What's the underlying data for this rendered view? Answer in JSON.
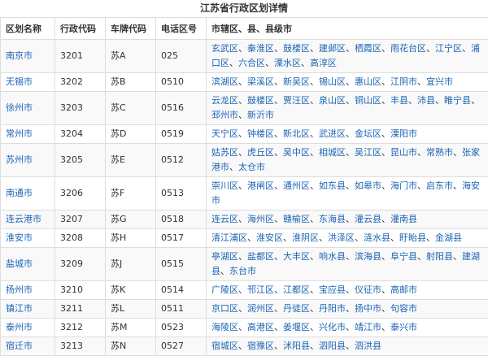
{
  "title": "江苏省行政区划详情",
  "headers": [
    "区划名称",
    "行政代码",
    "车牌代码",
    "电话区号",
    "市辖区、县、县级市"
  ],
  "rows": [
    {
      "name": "南京市",
      "code": "3201",
      "plate": "苏A",
      "area": "025",
      "subs": [
        "玄武区",
        "秦淮区",
        "鼓楼区",
        "建邺区",
        "栖霞区",
        "雨花台区",
        "江宁区",
        "浦口区",
        "六合区",
        "溧水区",
        "高淳区"
      ]
    },
    {
      "name": "无锡市",
      "code": "3202",
      "plate": "苏B",
      "area": "0510",
      "subs": [
        "滨湖区",
        "梁溪区",
        "新吴区",
        "锡山区",
        "惠山区",
        "江阴市",
        "宜兴市"
      ]
    },
    {
      "name": "徐州市",
      "code": "3203",
      "plate": "苏C",
      "area": "0516",
      "subs": [
        "云龙区",
        "鼓楼区",
        "贾汪区",
        "泉山区",
        "铜山区",
        "丰县",
        "沛县",
        "睢宁县",
        "邳州市",
        "新沂市"
      ]
    },
    {
      "name": "常州市",
      "code": "3204",
      "plate": "苏D",
      "area": "0519",
      "subs": [
        "天宁区",
        "钟楼区",
        "新北区",
        "武进区",
        "金坛区",
        "溧阳市"
      ]
    },
    {
      "name": "苏州市",
      "code": "3205",
      "plate": "苏E",
      "area": "0512",
      "subs": [
        "姑苏区",
        "虎丘区",
        "吴中区",
        "相城区",
        "吴江区",
        "昆山市",
        "常熟市",
        "张家港市",
        "太仓市"
      ]
    },
    {
      "name": "南通市",
      "code": "3206",
      "plate": "苏F",
      "area": "0513",
      "subs": [
        "崇川区",
        "港闸区",
        "通州区",
        "如东县",
        "如皋市",
        "海门市",
        "启东市",
        "海安市"
      ]
    },
    {
      "name": "连云港市",
      "code": "3207",
      "plate": "苏G",
      "area": "0518",
      "subs": [
        "连云区",
        "海州区",
        "赣榆区",
        "东海县",
        "灌云县",
        "灌南县"
      ]
    },
    {
      "name": "淮安市",
      "code": "3208",
      "plate": "苏H",
      "area": "0517",
      "subs": [
        "清江浦区",
        "淮安区",
        "淮阴区",
        "洪泽区",
        "涟水县",
        "盱眙县",
        "金湖县"
      ]
    },
    {
      "name": "盐城市",
      "code": "3209",
      "plate": "苏J",
      "area": "0515",
      "subs": [
        "亭湖区",
        "盐都区",
        "大丰区",
        "响水县",
        "滨海县",
        "阜宁县",
        "射阳县",
        "建湖县",
        "东台市"
      ]
    },
    {
      "name": "扬州市",
      "code": "3210",
      "plate": "苏K",
      "area": "0514",
      "subs": [
        "广陵区",
        "邗江区",
        "江都区",
        "宝应县",
        "仪征市",
        "高邮市"
      ]
    },
    {
      "name": "镇江市",
      "code": "3211",
      "plate": "苏L",
      "area": "0511",
      "subs": [
        "京口区",
        "润州区",
        "丹徒区",
        "丹阳市",
        "扬中市",
        "句容市"
      ]
    },
    {
      "name": "泰州市",
      "code": "3212",
      "plate": "苏M",
      "area": "0523",
      "subs": [
        "海陵区",
        "高港区",
        "姜堰区",
        "兴化市",
        "靖江市",
        "泰兴市"
      ]
    },
    {
      "name": "宿迁市",
      "code": "3213",
      "plate": "苏N",
      "area": "0527",
      "subs": [
        "宿城区",
        "宿豫区",
        "沭阳县",
        "泗阳县",
        "泗洪县"
      ]
    }
  ],
  "colors": {
    "link": "#1b64b4",
    "border": "#dddddd",
    "stripe": "#f9f9f9"
  }
}
